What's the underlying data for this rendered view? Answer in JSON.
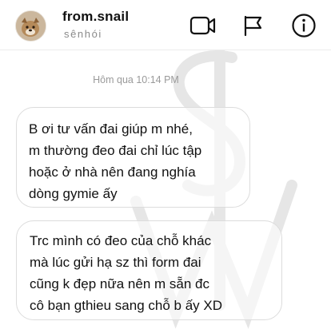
{
  "header": {
    "username": "from.snail",
    "status": "sênhói",
    "icons": {
      "video": "video-call-icon",
      "flag": "flag-icon",
      "info": "info-icon"
    }
  },
  "conversation": {
    "timestamp": "Hôm qua 10:14 PM",
    "messages": [
      {
        "lines": [
          "B ơi tư vấn đai giúp m nhé,",
          "m thường đeo đai chỉ lúc tập",
          "hoặc ở nhà nên đang nghía",
          "dòng gymie ấy"
        ]
      },
      {
        "lines": [
          "Trc mình có đeo của chỗ khác",
          "mà lúc gửi hạ sz thì form đai",
          "cũng k đẹp nữa nên m sẵn đc",
          "cô bạn gthieu sang chỗ b ấy XD"
        ]
      }
    ]
  },
  "colors": {
    "text": "#111111",
    "muted": "#8a8a8a",
    "bubble_border": "#dcdcdc",
    "watermark": "#e4e4e4"
  }
}
